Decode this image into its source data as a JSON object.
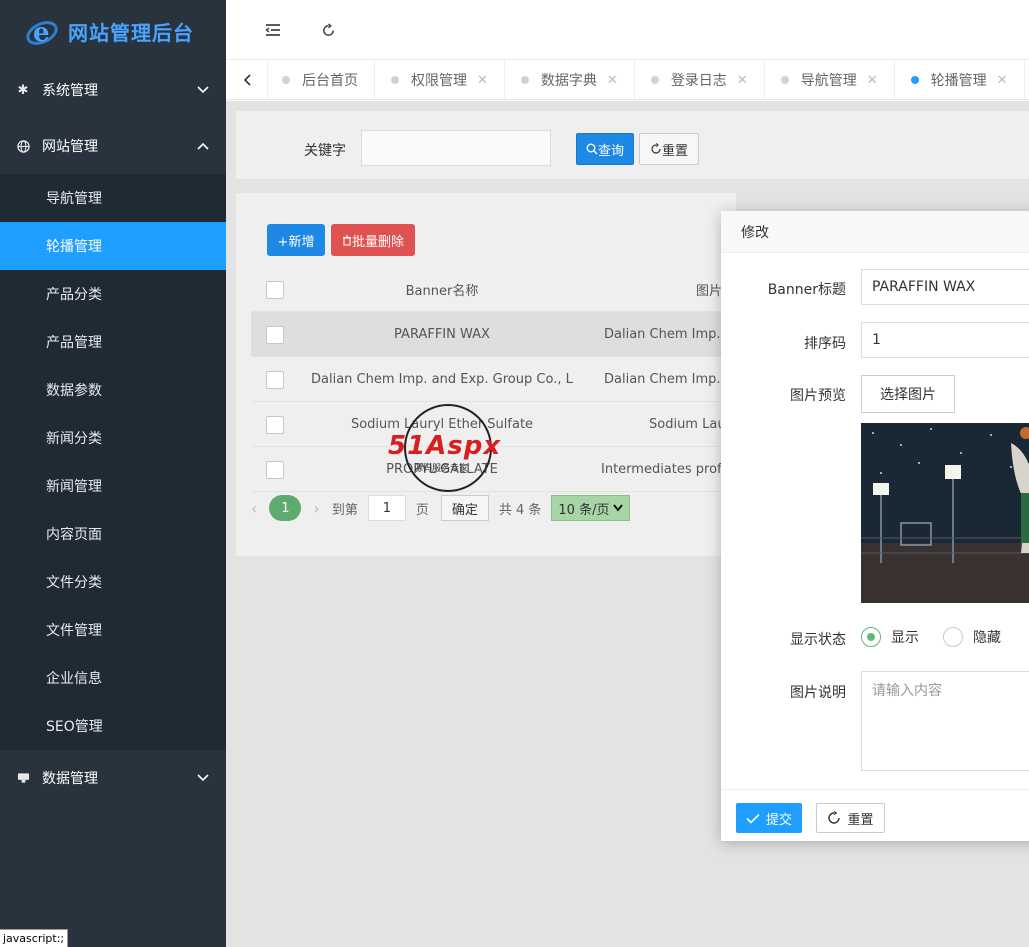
{
  "app": {
    "title": "网站管理后台"
  },
  "sidebar": {
    "groups": [
      {
        "label": "系统管理",
        "icon": "gear-icon",
        "expanded": false
      },
      {
        "label": "网站管理",
        "icon": "globe-icon",
        "expanded": true
      },
      {
        "label": "数据管理",
        "icon": "database-icon",
        "expanded": false
      }
    ],
    "items": [
      "导航管理",
      "轮播管理",
      "产品分类",
      "产品管理",
      "数据参数",
      "新闻分类",
      "新闻管理",
      "内容页面",
      "文件分类",
      "文件管理",
      "企业信息",
      "SEO管理"
    ],
    "active_item": "轮播管理"
  },
  "tabs": [
    {
      "label": "后台首页",
      "closable": false,
      "active": false
    },
    {
      "label": "权限管理",
      "closable": true,
      "active": false
    },
    {
      "label": "数据字典",
      "closable": true,
      "active": false
    },
    {
      "label": "登录日志",
      "closable": true,
      "active": false
    },
    {
      "label": "导航管理",
      "closable": true,
      "active": false
    },
    {
      "label": "轮播管理",
      "closable": true,
      "active": true
    }
  ],
  "search": {
    "label": "关键字",
    "value": "",
    "query_label": "查询",
    "reset_label": "重置"
  },
  "toolbar": {
    "add_label": "+新增",
    "batch_delete_label": "批量删除"
  },
  "table": {
    "headers": [
      "Banner名称",
      "图片说明"
    ],
    "header_visible_desc": "图片",
    "rows": [
      {
        "name": "PARAFFIN WAX",
        "desc": "Dalian Chem Imp. and Exp. Group Co., Ltd."
      },
      {
        "name": "Dalian Chem Imp. and Exp. Group Co., Ltd.",
        "desc": "Dalian Chem Imp. and Exp. Group Co., Ltd."
      },
      {
        "name": "Sodium Lauryl Ether Sulfate",
        "desc": "Sodium Lauryl Ether Sulfate"
      },
      {
        "name": "PROPYL GALLATE",
        "desc": "Intermediates professional manufacturer"
      }
    ]
  },
  "pager": {
    "current": "1",
    "goto_label": "到第",
    "goto_value": "1",
    "page_unit": "页",
    "confirm_label": "确定",
    "total_label": "共 4 条",
    "page_size_label": "10 条/页"
  },
  "watermark": {
    "brand": "51Aspx",
    "tagline": "源码服务专家"
  },
  "modal": {
    "title": "修改",
    "fields": {
      "banner_title_label": "Banner标题",
      "banner_title_value": "PARAFFIN WAX",
      "sort_label": "排序码",
      "sort_value": "1",
      "preview_label": "图片预览",
      "choose_label": "选择图片",
      "status_label": "显示状态",
      "status_show": "显示",
      "status_hide": "隐藏",
      "desc_label": "图片说明",
      "desc_placeholder": "请输入内容"
    },
    "submit_label": "提交",
    "reset_label": "重置"
  },
  "statusbar": {
    "text": "javascript:;"
  },
  "colors": {
    "sidebar_bg": "#28333e",
    "active_blue": "#1e9fff",
    "logo_blue": "#4aa3ff",
    "success_green": "#5fb878",
    "danger_red": "#e05252"
  }
}
